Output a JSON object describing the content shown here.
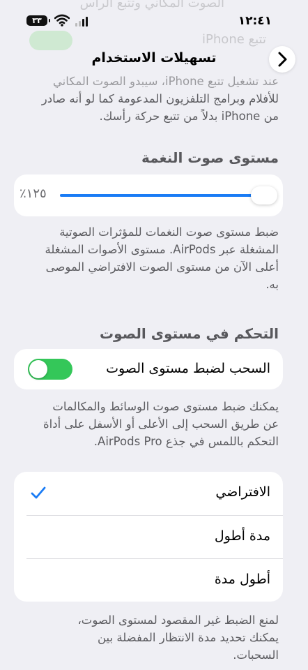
{
  "status": {
    "time": "١٢:٤١",
    "battery": "٣٣"
  },
  "ghost": {
    "line1": "الصوت المكاني وتتبع الرأس",
    "line2": "تتبع iPhone"
  },
  "nav": {
    "title": "تسهيلات الاستخدام"
  },
  "intro": {
    "line1": "عند تشغيل تتبع iPhone، سيبدو الصوت المكاني",
    "line2": "للأفلام وبرامج التلفزيون المدعومة كما لو أنه صادر",
    "line3": "من iPhone بدلاً من تتبع حركة رأسك."
  },
  "tone": {
    "header": "مستوى صوت النغمة",
    "value_label": "١٢٥٪",
    "level_fraction": 0.97,
    "footer_line1": "ضبط مستوى صوت النغمات للمؤثرات الصوتية",
    "footer_line2": "المشغلة عبر AirPods. مستوى الأصوات المشغلة",
    "footer_line3": "أعلى الآن من مستوى الصوت الافتراضي الموصى",
    "footer_line4": "به."
  },
  "volume_control": {
    "header": "التحكم في مستوى الصوت",
    "swipe_label": "السحب لضبط مستوى الصوت",
    "swipe_on": true,
    "footer_line1": "يمكنك ضبط مستوى صوت الوسائط والمكالمات",
    "footer_line2": "عن طريق السحب إلى الأعلى أو الأسفل على أداة",
    "footer_line3": "التحكم باللمس في جذع AirPods Pro."
  },
  "duration": {
    "options": [
      {
        "label": "الافتراضي",
        "selected": true
      },
      {
        "label": "مدة أطول",
        "selected": false
      },
      {
        "label": "أطول مدة",
        "selected": false
      }
    ],
    "footer_line1": "لمنع الضبط غير المقصود لمستوى الصوت،",
    "footer_line2": "يمكنك تحديد مدة الانتظار المفضلة بين",
    "footer_line3": "السحبات."
  },
  "colors": {
    "accent": "#1a7cf5",
    "toggle_on": "#34c759",
    "background": "#efeff4"
  }
}
